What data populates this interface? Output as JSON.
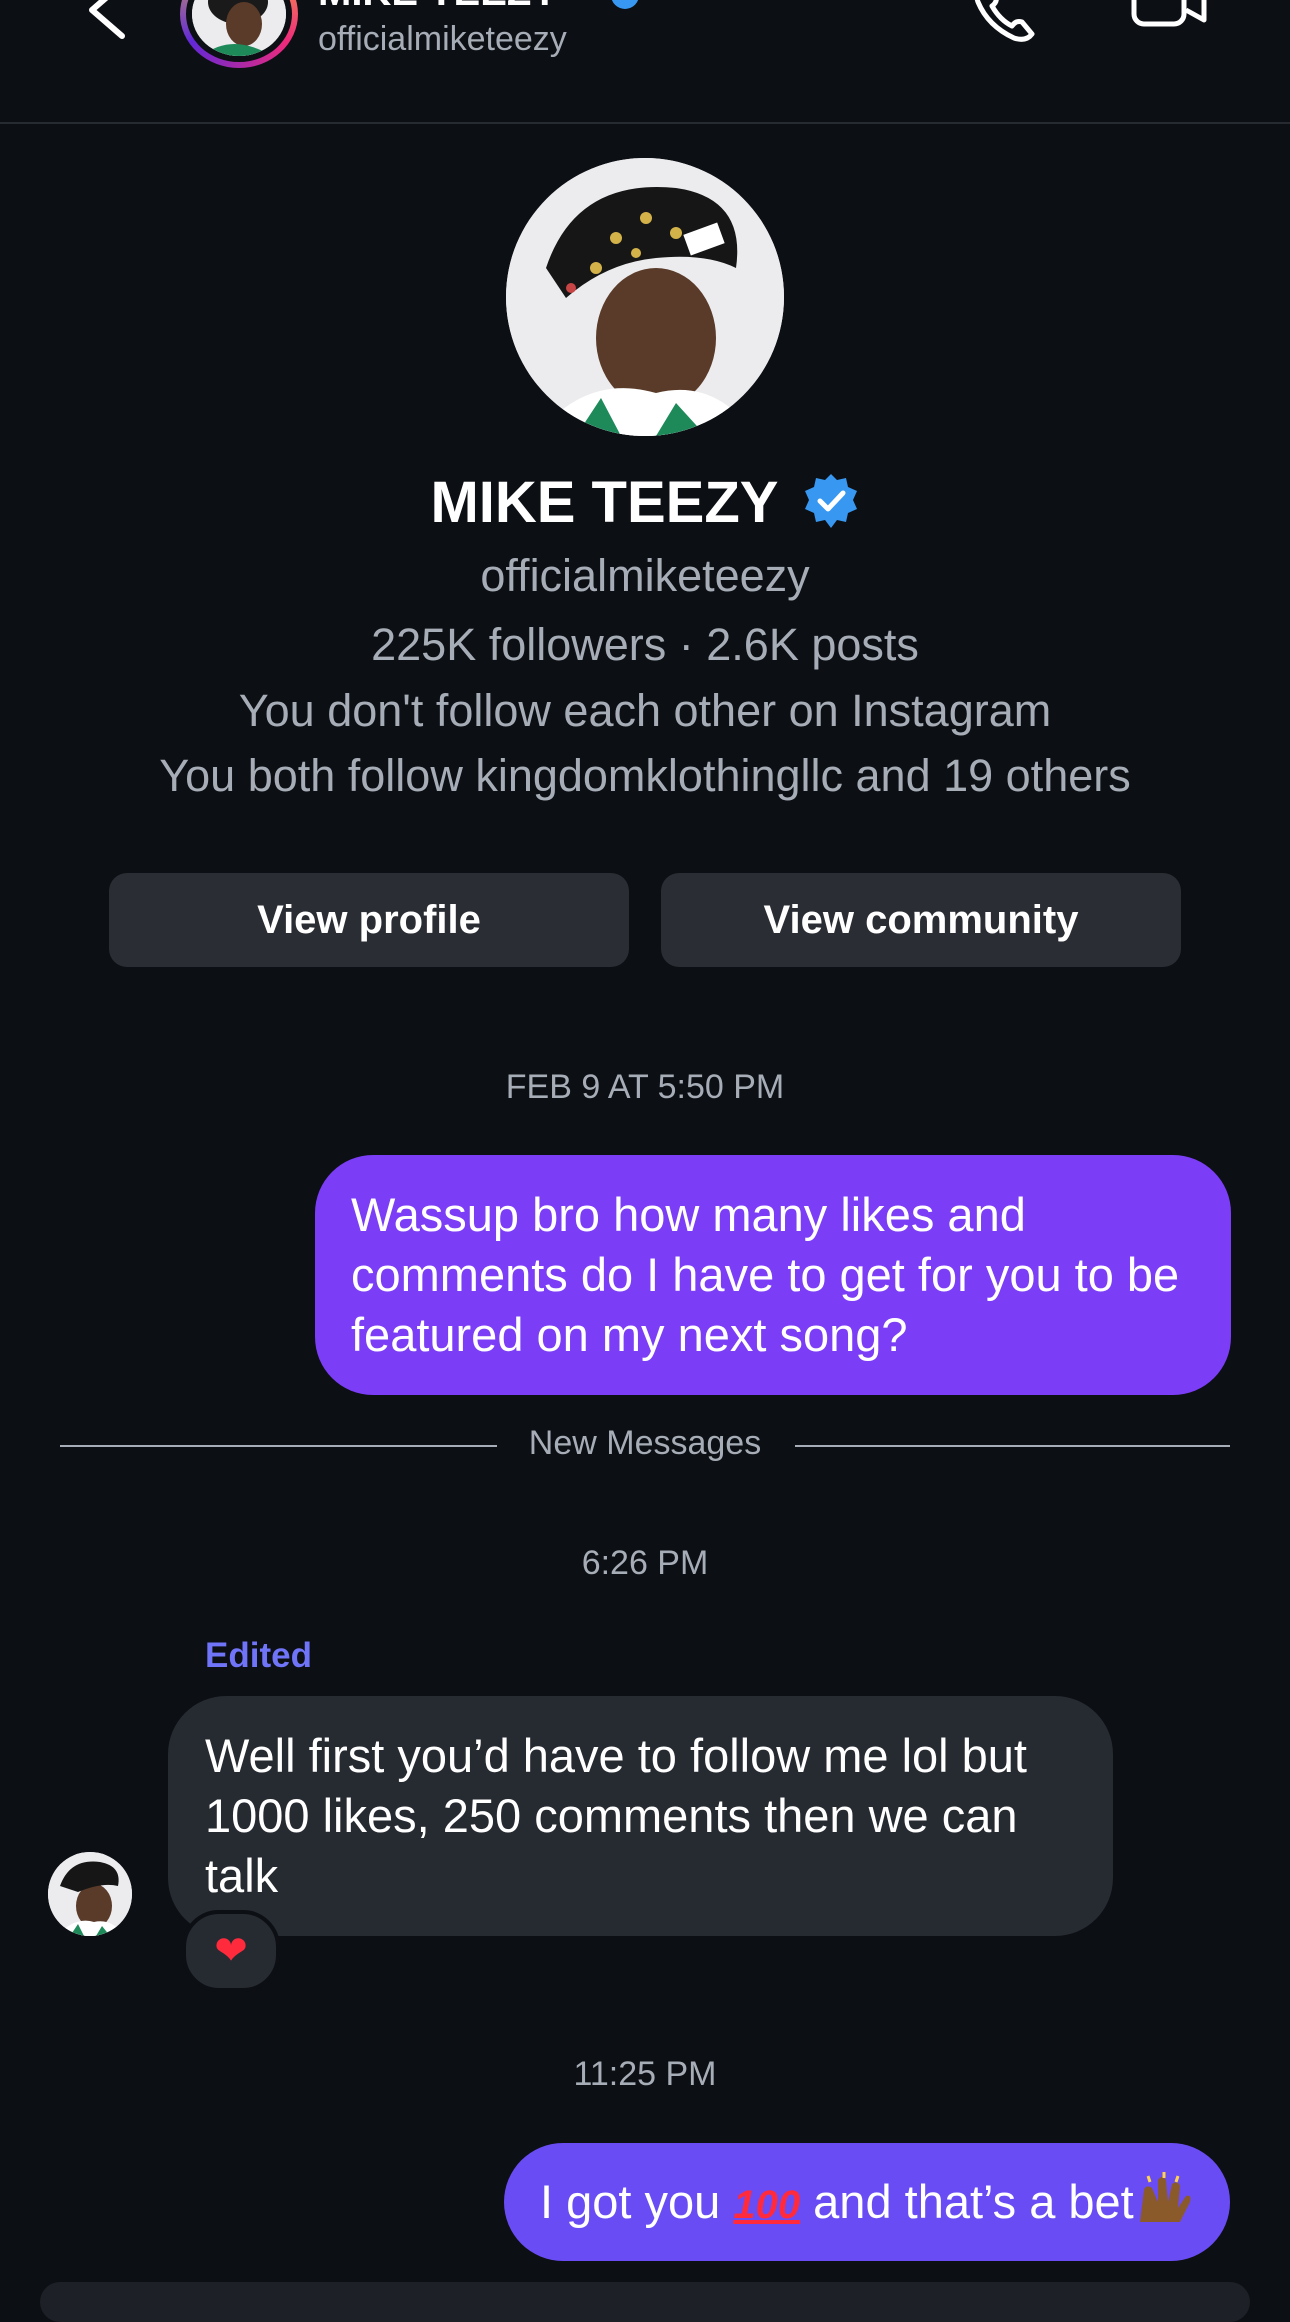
{
  "header": {
    "title": "MIKE TEEZY",
    "username": "officialmiketeezy"
  },
  "profile": {
    "name": "MIKE TEEZY",
    "username": "officialmiketeezy",
    "stats": "225K followers · 2.6K posts",
    "follow_status": "You don't follow each other on Instagram",
    "mutual": "You both follow kingdomklothingllc and 19 others",
    "view_profile_label": "View profile",
    "view_community_label": "View community"
  },
  "messages": {
    "timestamp_1": "FEB 9 AT 5:50 PM",
    "outgoing_1_lines": [
      "Wassup bro how many likes and",
      "comments do I have to get for you to be",
      "featured on my next song?"
    ],
    "new_messages_label": "New Messages",
    "timestamp_2": "6:26 PM",
    "edited_label": "Edited",
    "incoming_1_lines": [
      "Well first you’d have to follow me lol but",
      "1000 likes, 250 comments then we can",
      "talk"
    ],
    "reaction": "❤",
    "timestamp_3": "11:25 PM",
    "outgoing_2_text": "I got you",
    "outgoing_2_emoji": "100",
    "outgoing_2_text_end": "and that’s a bet"
  },
  "colors": {
    "background": "#0c0f14",
    "outgoing_bubble": "#7b3df5",
    "outgoing_bubble_2": "#6a4cf5",
    "incoming_bubble": "#262a31",
    "secondary_text": "#a7adb6",
    "verified_blue": "#3897f0",
    "edited_label": "#6f74f8"
  },
  "icons": [
    "back-chevron-icon",
    "verified-badge-icon",
    "phone-call-icon",
    "video-camera-icon",
    "heart-reaction-icon",
    "hundred-points-emoji",
    "raised-hands-emoji"
  ]
}
